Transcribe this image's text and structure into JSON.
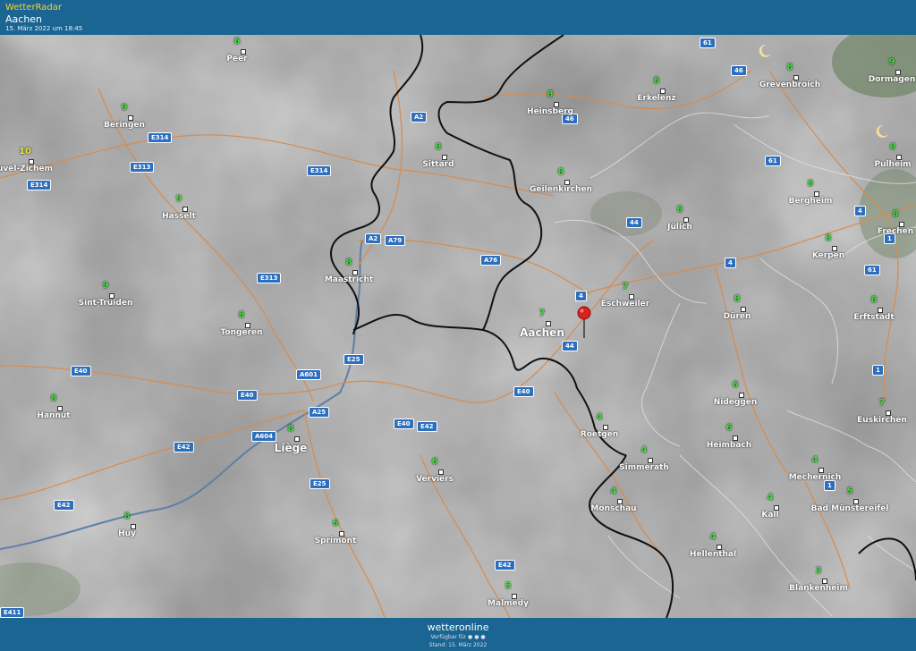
{
  "header": {
    "app_title": "WetterRadar",
    "location": "Aachen",
    "timestamp": "15. März 2022 um 18:45"
  },
  "footer": {
    "brand": "wetteronline",
    "availability": "Verfügbar für ● ● ●",
    "stand": "Stand: 15. März 2022"
  },
  "cities": [
    {
      "name": "Peer",
      "value": "6"
    },
    {
      "name": "Beringen",
      "value": "9"
    },
    {
      "name": "uvel-Zichem",
      "value": "10"
    },
    {
      "name": "Hasselt",
      "value": "9"
    },
    {
      "name": "Sint-Truiden",
      "value": "9"
    },
    {
      "name": "Tongeren",
      "value": "8"
    },
    {
      "name": "Hannut",
      "value": "8"
    },
    {
      "name": "Liège",
      "value": "8"
    },
    {
      "name": "Huy",
      "value": "8"
    },
    {
      "name": "Sittard",
      "value": "8"
    },
    {
      "name": "Heinsberg",
      "value": "8"
    },
    {
      "name": "Geilenkirchen",
      "value": "8"
    },
    {
      "name": "Erkelenz",
      "value": "8"
    },
    {
      "name": "Grevenbroich",
      "value": "8"
    },
    {
      "name": "Dormagen",
      "value": "9"
    },
    {
      "name": "Pulheim",
      "value": "8"
    },
    {
      "name": "Maastricht",
      "value": "8"
    },
    {
      "name": "Jülich",
      "value": "8"
    },
    {
      "name": "Bergheim",
      "value": "8"
    },
    {
      "name": "Frechen",
      "value": "8"
    },
    {
      "name": "Kerpen",
      "value": "8"
    },
    {
      "name": "Eschweiler",
      "value": "7"
    },
    {
      "name": "Aachen",
      "value": "7"
    },
    {
      "name": "Düren",
      "value": "8"
    },
    {
      "name": "Erftstadt",
      "value": "8"
    },
    {
      "name": "Nideggen",
      "value": "6"
    },
    {
      "name": "Euskirchen",
      "value": "7"
    },
    {
      "name": "Roetgen",
      "value": "4"
    },
    {
      "name": "Heimbach",
      "value": "6"
    },
    {
      "name": "Simmerath",
      "value": "4"
    },
    {
      "name": "Mechernich",
      "value": "4"
    },
    {
      "name": "Monschau",
      "value": "4"
    },
    {
      "name": "Kall",
      "value": "4"
    },
    {
      "name": "Bad Münstereifel",
      "value": "5"
    },
    {
      "name": "Verviers",
      "value": "6"
    },
    {
      "name": "Sprimont",
      "value": "6"
    },
    {
      "name": "Hellenthal",
      "value": "4"
    },
    {
      "name": "Blankenheim",
      "value": "3"
    },
    {
      "name": "Malmedy",
      "value": "5"
    }
  ],
  "road_shields": [
    "E314",
    "E314",
    "E314",
    "E313",
    "E313",
    "A2",
    "A2",
    "A79",
    "A76",
    "E40",
    "E40",
    "E40",
    "E40",
    "E42",
    "E42",
    "E42",
    "E42",
    "A601",
    "E25",
    "E25",
    "A25",
    "A604",
    "4",
    "4",
    "4",
    "4",
    "44",
    "44",
    "46",
    "46",
    "61",
    "61",
    "61",
    "1",
    "1",
    "1",
    "E411"
  ],
  "colors": {
    "bar": "#1a6592",
    "accent": "#f3d23a",
    "value_green": "#3fdc3f",
    "value_yellow": "#e6e93a",
    "shield": "#2d6fbf",
    "pin": "#d8221c"
  }
}
